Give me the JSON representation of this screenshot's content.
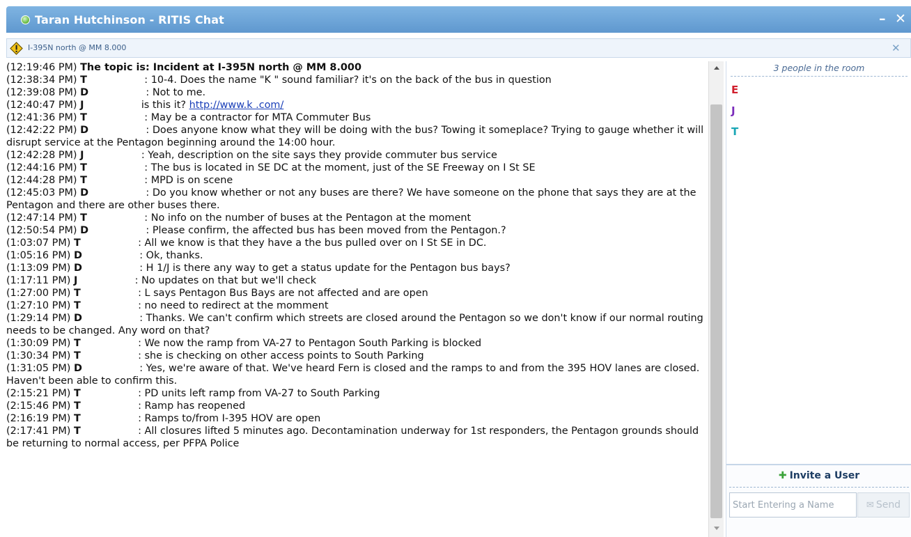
{
  "window": {
    "title": "Taran Hutchinson - RITIS Chat",
    "minimize_glyph": "–",
    "close_glyph": "✕"
  },
  "topic_bar": {
    "text": "I-395N north @ MM 8.000",
    "icon": "warning-icon",
    "close_glyph": "✕"
  },
  "messages": [
    {
      "ts": "(12:19:46 PM)",
      "topic": "The topic is: Incident at I-395N north @ MM 8.000"
    },
    {
      "ts": "(12:38:34 PM)",
      "name": "T",
      "text": ": 10-4. Does the name \"K        \" sound familiar? it's on the back of the bus in question"
    },
    {
      "ts": "(12:39:08 PM)",
      "name": "D",
      "text": ": Not to me."
    },
    {
      "ts": "(12:40:47 PM)",
      "name": "J",
      "text": "is this it?",
      "link": "http://www.k              .com/"
    },
    {
      "ts": "(12:41:36 PM)",
      "name": "T",
      "text": ": May be a contractor for MTA Commuter Bus"
    },
    {
      "ts": "(12:42:22 PM)",
      "name": "D",
      "text": ": Does anyone know what they will be doing with the bus? Towing it someplace? Trying to gauge whether it will disrupt service at the Pentagon beginning around the 14:00 hour."
    },
    {
      "ts": "(12:42:28 PM)",
      "name": "J",
      "text": ": Yeah, description on the site says they provide commuter bus service"
    },
    {
      "ts": "(12:44:16 PM)",
      "name": "T",
      "text": ": The bus is located in SE DC at the moment, just of the SE Freeway on I St SE"
    },
    {
      "ts": "(12:44:28 PM)",
      "name": "T",
      "text": ": MPD is on scene"
    },
    {
      "ts": "(12:45:03 PM)",
      "name": "D",
      "text": ": Do you know whether or not any buses are there? We have someone on the phone that says they are at the Pentagon and there are other buses there."
    },
    {
      "ts": "(12:47:14 PM)",
      "name": "T",
      "text": ": No info on the number of buses at the Pentagon at the moment"
    },
    {
      "ts": "(12:50:54 PM)",
      "name": "D",
      "text": ": Please confirm, the affected bus has been moved from the Pentagon.?"
    },
    {
      "ts": "(1:03:07 PM)",
      "name": "T",
      "text": ": All we know is that they have a the bus pulled over on I St SE in DC."
    },
    {
      "ts": "(1:05:16 PM)",
      "name": "D",
      "text": ": Ok, thanks."
    },
    {
      "ts": "(1:13:09 PM)",
      "name": "D",
      "text": ": H      1/J       is there any way to get a status update for the Pentagon bus bays?"
    },
    {
      "ts": "(1:17:11 PM)",
      "name": "J",
      "text": ": No updates on that but we'll check"
    },
    {
      "ts": "(1:27:00 PM)",
      "name": "T",
      "text": ": L       says Pentagon Bus Bays are not affected and are open"
    },
    {
      "ts": "(1:27:10 PM)",
      "name": "T",
      "text": ": no need to redirect at the momment"
    },
    {
      "ts": "(1:29:14 PM)",
      "name": "D",
      "text": ": Thanks. We can't confirm which streets are closed around the Pentagon so we don't know if our normal routing needs to be changed. Any word on that?"
    },
    {
      "ts": "(1:30:09 PM)",
      "name": "T",
      "text": ": We now the ramp from VA-27 to Pentagon South Parking is blocked"
    },
    {
      "ts": "(1:30:34 PM)",
      "name": "T",
      "text": ": she is checking on other access points to South Parking"
    },
    {
      "ts": "(1:31:05 PM)",
      "name": "D",
      "text": ": Yes, we're aware of that. We've heard Fern is closed and the ramps to and from the 395 HOV lanes are closed. Haven't been able to confirm this."
    },
    {
      "ts": "(2:15:21 PM)",
      "name": "T",
      "text": ": PD units left ramp from VA-27 to South Parking"
    },
    {
      "ts": "(2:15:46 PM)",
      "name": "T",
      "text": ": Ramp has reopened"
    },
    {
      "ts": "(2:16:19 PM)",
      "name": "T",
      "text": ": Ramps to/from I-395 HOV are open"
    },
    {
      "ts": "(2:17:41 PM)",
      "name": "T",
      "text": ": All closures lifted 5 minutes ago. Decontamination underway for 1st responders, the Pentagon grounds should be returning to normal access, per PFPA Police"
    }
  ],
  "sidebar": {
    "room_count": "3 people in the room",
    "users": [
      "E",
      "J",
      "T"
    ],
    "user_colors": [
      "#d0202e",
      "#7b2dbb",
      "#19a6b5"
    ],
    "invite_label": "Invite a User",
    "invite_icon": "plus-icon",
    "name_placeholder": "Start Entering a Name",
    "send_label": "Send",
    "send_icon": "envelope-icon"
  },
  "colors": {
    "titlebar": "#6fa6d8",
    "link": "#1a3fb8"
  }
}
